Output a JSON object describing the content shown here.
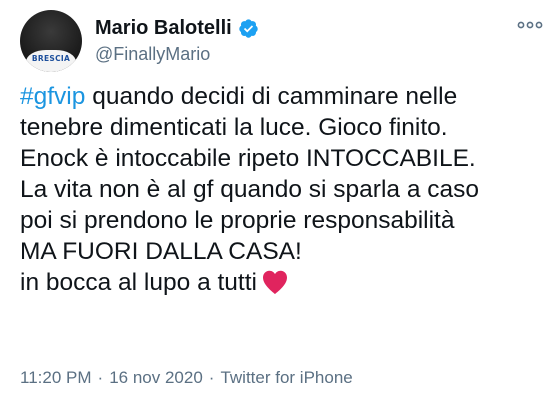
{
  "user": {
    "display_name": "Mario Balotelli",
    "handle": "@FinallyMario",
    "avatar_text": "BRESCIA",
    "verified": true
  },
  "tweet": {
    "hashtag": "#gfvip",
    "line1_rest": " quando decidi di camminare nelle",
    "lines": [
      "tenebre dimenticati la luce. Gioco finito.",
      "Enock è intoccabile ripeto INTOCCABILE.",
      "La vita non è al gf quando si sparla a caso",
      "poi si prendono le proprie responsabilità",
      "MA FUORI DALLA CASA!"
    ],
    "last_line": "in bocca al lupo a tutti",
    "emoji": "red-heart"
  },
  "meta": {
    "time": "11:20 PM",
    "date": "16 nov 2020",
    "separator": "·",
    "source": "Twitter for iPhone"
  },
  "colors": {
    "link": "#1b95e0",
    "text": "#0f1419",
    "secondary": "#5b7083",
    "verified": "#1da1f2",
    "heart": "#e0245e"
  }
}
